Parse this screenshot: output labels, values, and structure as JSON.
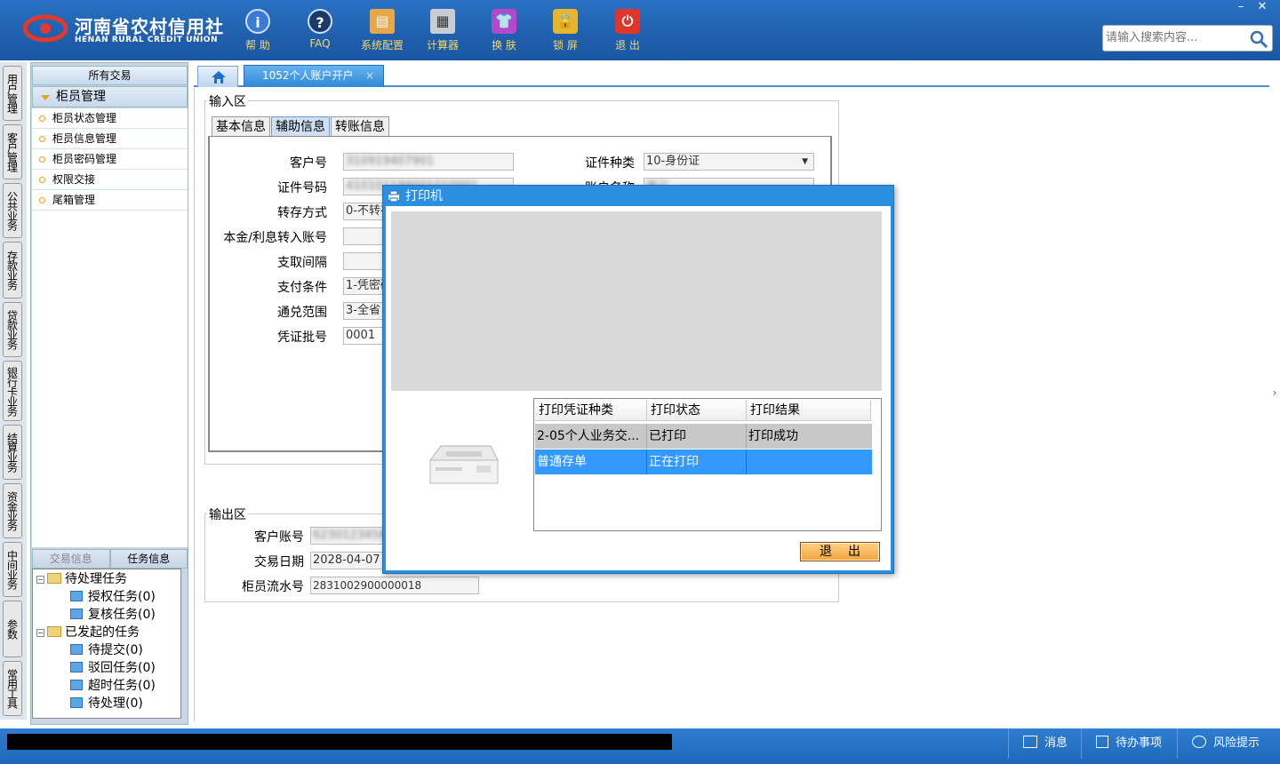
{
  "header": {
    "logo_cn": "河南省农村信用社",
    "logo_en": "HENAN RURAL CREDIT UNION",
    "toolbar": [
      {
        "label": "帮 助",
        "icon": "info-icon"
      },
      {
        "label": "FAQ",
        "icon": "question-icon"
      },
      {
        "label": "系统配置",
        "icon": "toolbox-icon"
      },
      {
        "label": "计算器",
        "icon": "calculator-icon"
      },
      {
        "label": "换 肤",
        "icon": "shirt-icon"
      },
      {
        "label": "锁 屏",
        "icon": "lock-icon"
      },
      {
        "label": "退 出",
        "icon": "power-icon"
      }
    ],
    "window_controls": {
      "minimize": "–",
      "close": "✕"
    },
    "search": {
      "placeholder": "请输入搜索内容...",
      "icon": "magnifier-icon"
    }
  },
  "vertical_tabs": [
    "用户管理",
    "客户管理",
    "公共业务",
    "存款业务",
    "贷款业务",
    "银行卡业务",
    "结算业务",
    "资金业务",
    "中间业务",
    "参数",
    "常用工具"
  ],
  "left_panel": {
    "header": "所有交易",
    "group": "柜员管理",
    "items": [
      "柜员状态管理",
      "柜员信息管理",
      "柜员密码管理",
      "权限交接",
      "尾箱管理"
    ],
    "bottom_tabs": [
      "交易信息",
      "任务信息"
    ],
    "tree": {
      "pending": {
        "label": "待处理任务",
        "children": [
          "授权任务(0)",
          "复核任务(0)"
        ]
      },
      "initiated": {
        "label": "已发起的任务",
        "children": [
          "待提交(0)",
          "驳回任务(0)",
          "超时任务(0)",
          "待处理(0)"
        ]
      }
    }
  },
  "tabs": {
    "home_icon": "home-icon",
    "active": "1052个人账户开户",
    "close": "×"
  },
  "input_area": {
    "legend": "输入区",
    "tabs": [
      "基本信息",
      "辅助信息",
      "转账信息"
    ],
    "active_tab": "辅助信息",
    "fields": {
      "customer_no": {
        "label": "客户号",
        "value": "310919407901"
      },
      "id_type": {
        "label": "证件种类",
        "value": "10-身份证"
      },
      "id_no": {
        "label": "证件号码",
        "value": "410101199001010001"
      },
      "account_name": {
        "label": "账户名称",
        "value": "张三"
      },
      "deposit_method": {
        "label": "转存方式",
        "value": "0-不转存"
      },
      "interest_account": {
        "label": "本金/利息转入账号",
        "value": ""
      },
      "withdraw_interval": {
        "label": "支取间隔",
        "value": ""
      },
      "pay_condition": {
        "label": "支付条件",
        "value": "1-凭密码"
      },
      "exchange_range": {
        "label": "通兑范围",
        "value": "3-全省"
      },
      "voucher_batch": {
        "label": "凭证批号",
        "value": "0001"
      }
    }
  },
  "output_area": {
    "legend": "输出区",
    "fields": {
      "customer_account": {
        "label": "客户账号",
        "value": "6230123456789012"
      },
      "trade_date": {
        "label": "交易日期",
        "value": "2028-04-07"
      },
      "teller_serial": {
        "label": "柜员流水号",
        "value": "2831002900000018"
      }
    }
  },
  "printer_dialog": {
    "title": "打印机",
    "columns": [
      "打印凭证种类",
      "打印状态",
      "打印结果"
    ],
    "rows": [
      {
        "type": "2-05个人业务交...",
        "status": "已打印",
        "result": "打印成功"
      },
      {
        "type": "普通存单",
        "status": "正在打印",
        "result": ""
      }
    ],
    "exit_button": "退出"
  },
  "status_bar": {
    "items": [
      {
        "label": "消息",
        "icon": "mail-icon"
      },
      {
        "label": "待办事项",
        "icon": "checkbox-icon"
      },
      {
        "label": "风险提示",
        "icon": "chat-icon"
      }
    ]
  },
  "colors": {
    "brand_blue": "#1f5fae",
    "dialog_blue": "#2b8fe0",
    "selected_row": "#3399ff",
    "accent_orange": "#f3a43a"
  }
}
